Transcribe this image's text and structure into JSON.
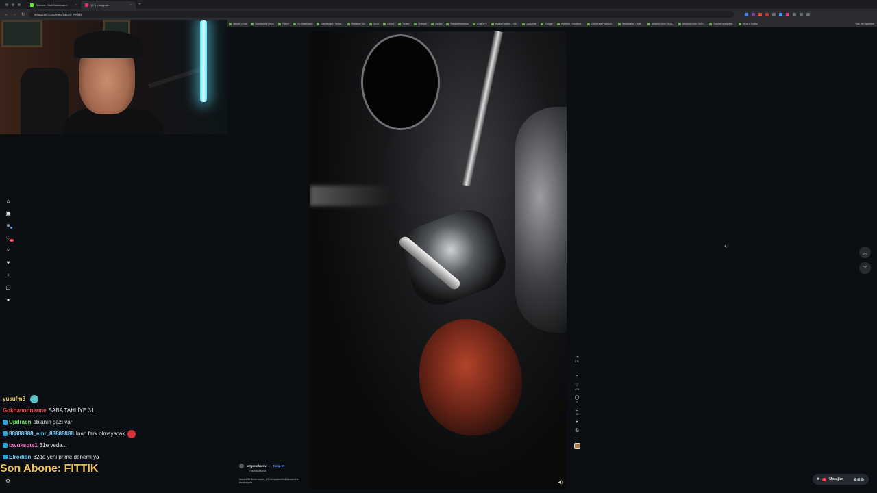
{
  "browser": {
    "tabs": [
      {
        "label": "Stream - Kick Dashboard",
        "favicon_color": "#53fc18",
        "active": false
      },
      {
        "label": "(9+) Instagram",
        "favicon_color": "#e1306c",
        "active": true
      }
    ],
    "url": "instagram.com/reels/DBcRi_PKfrk/",
    "bookmarks": [
      "xaloan | Kick",
      "Dashboard | Kick",
      "Twitch",
      "Yo Dashboard",
      "Dashboard | Strea...",
      "Streamer Ad",
      "Çevir",
      "iCloud",
      "Twitter",
      "Threads",
      "Ozusa",
      "StreamElements",
      "ChatGPT",
      "Radio Garden – Kit...",
      "AdSense",
      "Google",
      "Portfolio | Shuttere...",
      "Universal Producti...",
      "Streamaha – vide...",
      "Amazon.com: USB...",
      "Amazon.com: NOV...",
      "Submit a request...",
      "Drive & Listen"
    ],
    "other_bookmarks": "Tüm Yer İşaretleri"
  },
  "chat": {
    "messages": [
      {
        "user": "yusufm3",
        "text": "",
        "color": "#f5d76e",
        "emote_color": "#5ec4c9"
      },
      {
        "user": "Gokhanonnerme",
        "text": "BABA TAHLİYE 31",
        "color": "#ff4f4f",
        "emote_color": ""
      },
      {
        "user": "Updraen",
        "text": "ablanın gazı var",
        "color": "#6cf05f",
        "emote_color": ""
      },
      {
        "user": "88888888_emr_88888888",
        "text": "İnan fark olmayacak",
        "color": "#7fd4ff",
        "emote_color": "#d8323b"
      },
      {
        "user": "tavuksote1",
        "text": "31e veda...",
        "color": "#ff7dd6",
        "emote_color": ""
      },
      {
        "user": "Elrodion",
        "text": "32de yeni prime dönemi ya",
        "color": "#5bd2ff",
        "emote_color": ""
      }
    ],
    "sub_banner": "Son Abone: FITTIK"
  },
  "post": {
    "username": "artgoncharov",
    "follow_label": "Takip Et",
    "audio": "♫ achoichkova",
    "hashtags": "#bear650 #interceptor_650 #royalenfield #scrambler #motocycle"
  },
  "actions": {
    "likes": "478",
    "comments": "1",
    "reposts": "12",
    "views": "17K"
  },
  "messages_pill": {
    "label": "Mesajlar",
    "badge": "9"
  },
  "left_nav": {
    "notification_badge": "9+"
  }
}
